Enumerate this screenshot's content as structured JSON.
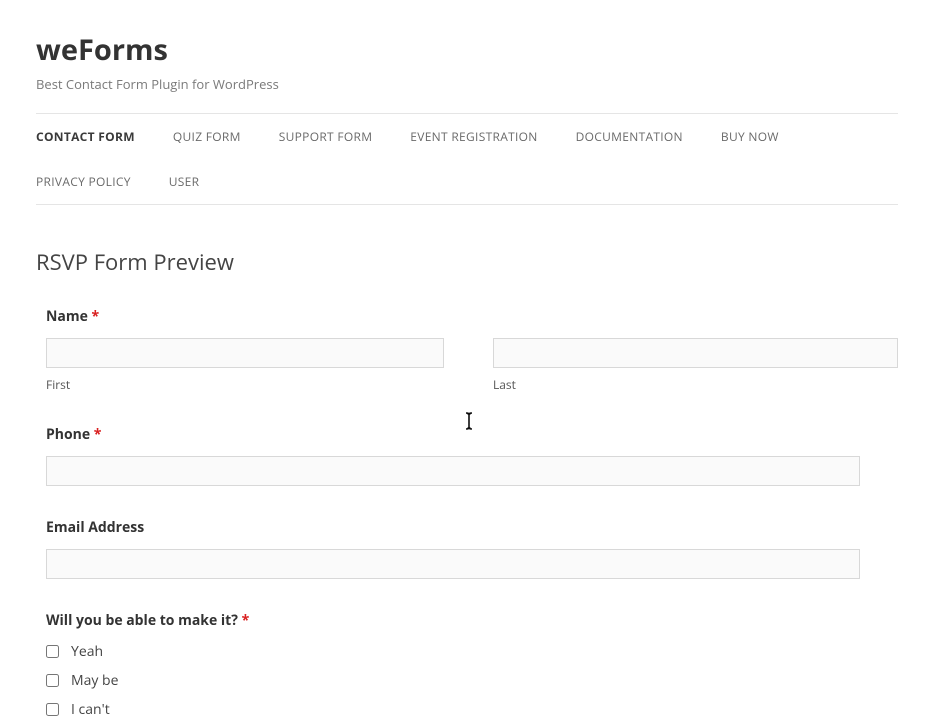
{
  "site": {
    "title": "weForms",
    "tagline": "Best Contact Form Plugin for WordPress"
  },
  "nav": {
    "items": [
      "CONTACT FORM",
      "QUIZ FORM",
      "SUPPORT FORM",
      "EVENT REGISTRATION",
      "DOCUMENTATION",
      "BUY NOW",
      "PRIVACY POLICY",
      "USER"
    ],
    "active_index": 0
  },
  "page": {
    "title": "RSVP Form Preview"
  },
  "form": {
    "name": {
      "label": "Name",
      "required": true,
      "first_sublabel": "First",
      "last_sublabel": "Last",
      "first_value": "",
      "last_value": ""
    },
    "phone": {
      "label": "Phone",
      "required": true,
      "value": ""
    },
    "email": {
      "label": "Email Address",
      "required": false,
      "value": ""
    },
    "attend": {
      "label": "Will you be able to make it?",
      "required": true,
      "options": [
        "Yeah",
        "May be",
        "I can't"
      ]
    }
  },
  "required_marker": "*"
}
